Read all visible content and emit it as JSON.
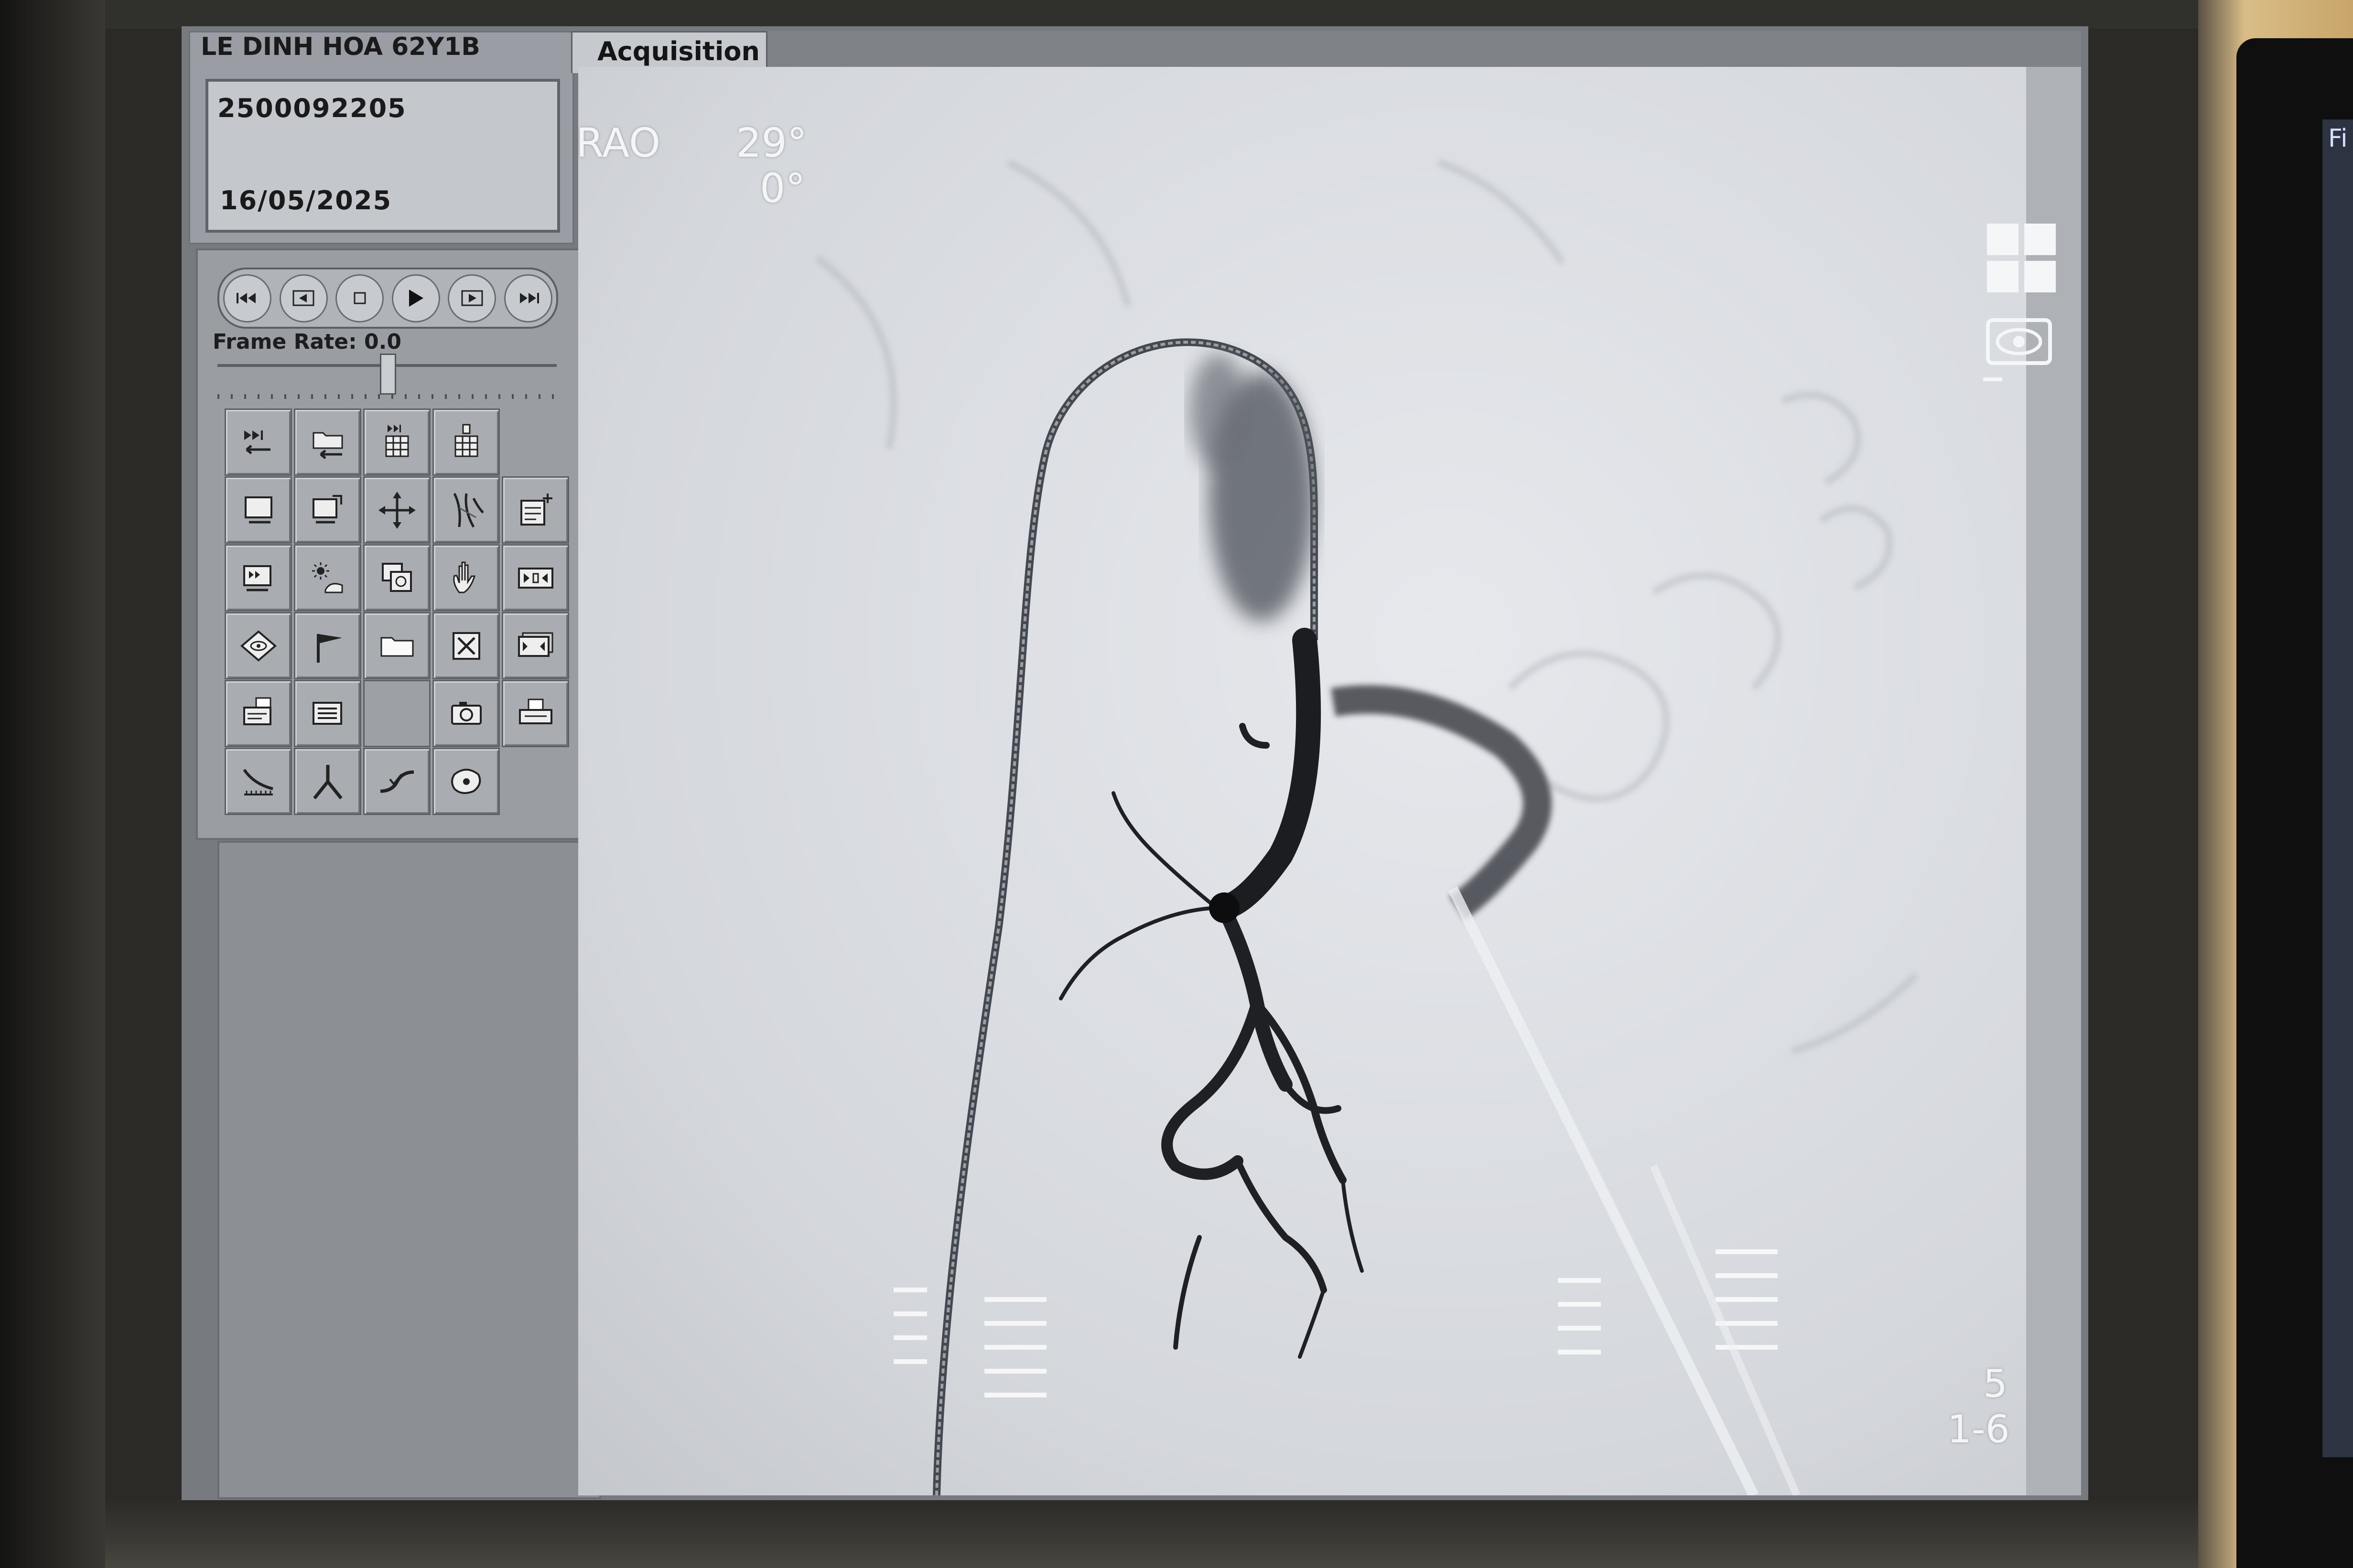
{
  "patient": {
    "name": "LE DINH HOA 62Y1B",
    "id": "2500092205",
    "date": "16/05/2025"
  },
  "tabs": [
    {
      "label": "Acquisition",
      "active": true
    }
  ],
  "playback": {
    "buttons": [
      "first-frame",
      "previous-frame",
      "stop",
      "play",
      "next-frame",
      "last-frame"
    ],
    "frame_rate_label": "Frame Rate: 0.0",
    "frame_rate_value": 0.0
  },
  "image_overlay": {
    "projection": "RAO",
    "angle_primary": "29°",
    "angle_secondary": "0°",
    "frame_number": "5",
    "frame_range": "1-6"
  },
  "tools": [
    "replay-run",
    "load-folder",
    "run-grid",
    "series-grid",
    "single-image",
    "copy-image",
    "pan-move",
    "vessel-analysis",
    "add-to-sheet",
    "subtraction-run",
    "brightness-contrast",
    "remask",
    "hand-roi",
    "zoom-fit",
    "flip-rotate",
    "flag-mark",
    "open-folder",
    "close-delete",
    "zoom-fit-alt",
    "print-report",
    "image-list",
    "empty",
    "snapshot-camera",
    "print-layout",
    "quantitative-analysis",
    "bifurcation",
    "stenosis",
    "landmark"
  ],
  "colors": {
    "screen_bg": "#777b80",
    "panel_bg": "#9a9ea3",
    "image_bg": "#dadde1",
    "overlay_text": "#f4f5f6",
    "vessel": "#1c1d20"
  },
  "side_monitor": {
    "text": "Fi"
  }
}
